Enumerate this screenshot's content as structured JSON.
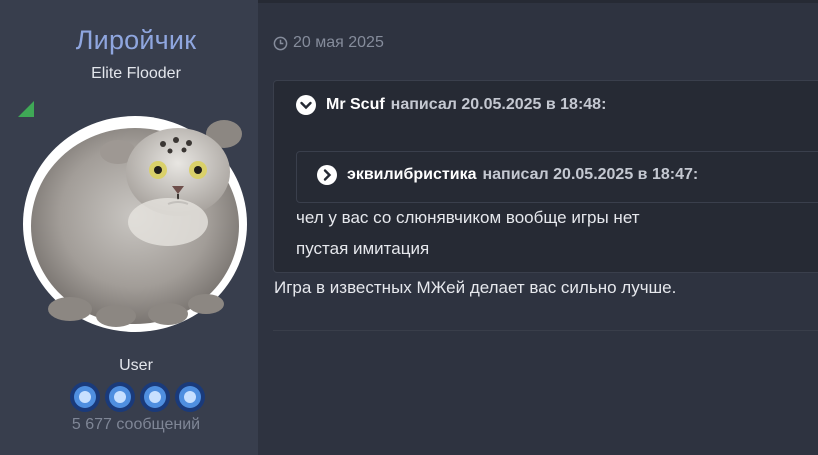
{
  "user": {
    "name": "Лиройчик",
    "title": "Elite Flooder",
    "role": "User",
    "message_count": "5 677 сообщений",
    "online_color": "#3fa856",
    "badges": [
      "award-icon",
      "award-icon",
      "award-icon",
      "award-icon"
    ]
  },
  "post": {
    "date": "20 мая 2025",
    "outer_quote": {
      "author": "Mr Scuf",
      "wrote": "написал 20.05.2025 в 18:48:",
      "inner_quote": {
        "author": "эквилибристика",
        "wrote": "написал 20.05.2025 в 18:47:"
      },
      "lines": [
        "чел у вас со слюнявчиком вообще игры нет",
        "пустая имитация"
      ]
    },
    "reply": "Игра в известных МЖей делает вас сильно лучше."
  }
}
